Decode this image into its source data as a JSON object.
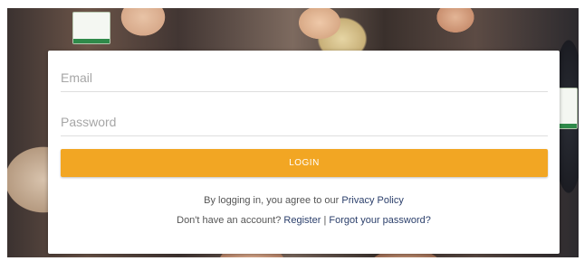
{
  "login_form": {
    "email_placeholder": "Email",
    "password_placeholder": "Password",
    "login_button_label": "LOGIN"
  },
  "legal": {
    "agree_prefix": "By logging in, you agree to our ",
    "privacy_policy_link": "Privacy Policy"
  },
  "account": {
    "no_account_prefix": "Don't have an account? ",
    "register_link": "Register",
    "separator": " | ",
    "forgot_password_link": "Forgot your password?"
  },
  "colors": {
    "accent": "#f2a623",
    "link": "#2b3f6b"
  }
}
